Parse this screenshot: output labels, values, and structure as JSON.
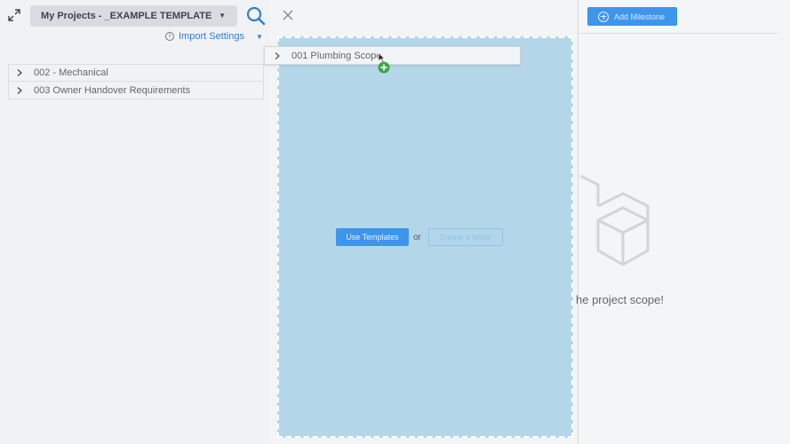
{
  "header": {
    "project_selector": "My Projects - _EXAMPLE TEMPLATE",
    "import_settings": "Import Settings"
  },
  "tree": {
    "items": [
      {
        "label": "002 - Mechanical"
      },
      {
        "label": "003   Owner Handover Requirements"
      }
    ]
  },
  "dragged_item": {
    "label": "001   Plumbing Scope"
  },
  "dropzone": {
    "use_templates_label": "Use Templates",
    "or_text": "or",
    "create_folder_label": "Create a folder"
  },
  "right": {
    "add_milestone_label": "Add Milestone",
    "empty_message": "he project scope!"
  },
  "colors": {
    "accent": "#3e95ec",
    "dropzone": "#b3d7e9",
    "link": "#2e7fd1",
    "add_badge": "#3aa845"
  },
  "icons": [
    "expand-icon",
    "search-icon",
    "close-icon",
    "info-icon",
    "chevron-right-icon",
    "plus-circle-icon",
    "cube-icon",
    "cursor-icon"
  ]
}
